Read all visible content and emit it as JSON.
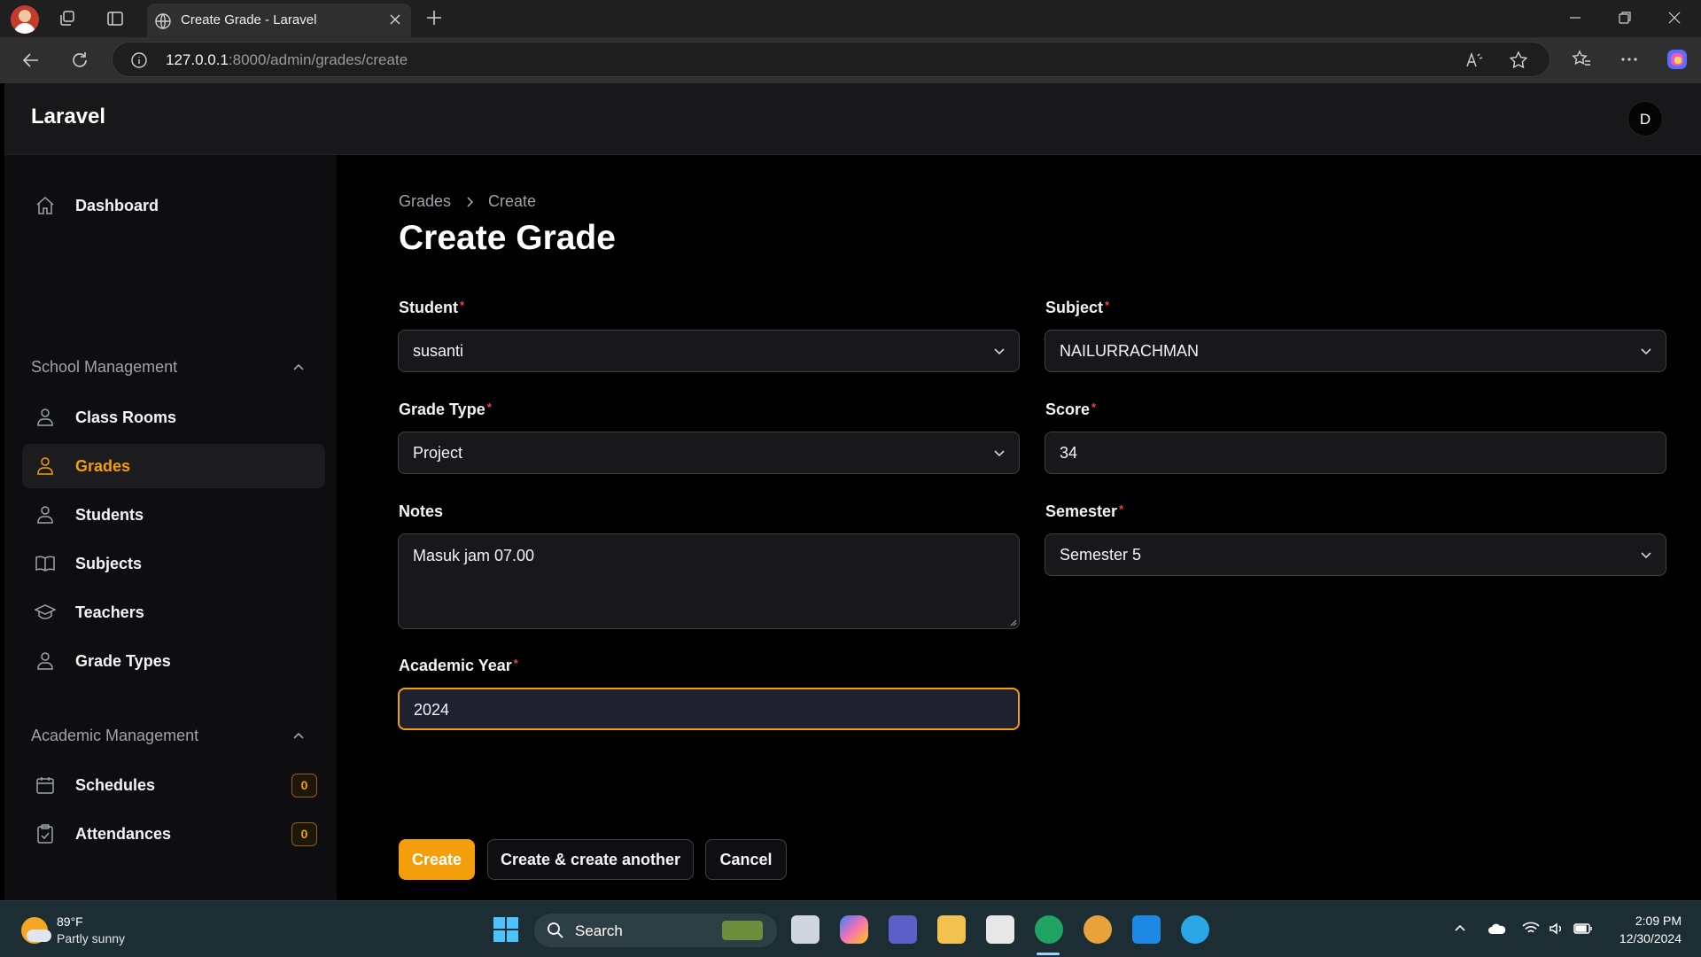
{
  "browser": {
    "tab_title": "Create Grade - Laravel",
    "url_host": "127.0.0.1",
    "url_rest": ":8000/admin/grades/create"
  },
  "app": {
    "brand": "Laravel",
    "avatar_initial": "D"
  },
  "sidebar": {
    "dashboard": "Dashboard",
    "group_school": "School Management",
    "school_items": [
      {
        "label": "Class Rooms",
        "icon": "user-icon"
      },
      {
        "label": "Grades",
        "icon": "user-icon",
        "active": true
      },
      {
        "label": "Students",
        "icon": "user-icon"
      },
      {
        "label": "Subjects",
        "icon": "book-icon"
      },
      {
        "label": "Teachers",
        "icon": "graduation-cap-icon"
      },
      {
        "label": "Grade Types",
        "icon": "user-icon"
      }
    ],
    "group_academic": "Academic Management",
    "academic_items": [
      {
        "label": "Schedules",
        "icon": "calendar-icon",
        "badge": "0"
      },
      {
        "label": "Attendances",
        "icon": "clipboard-check-icon",
        "badge": "0"
      }
    ]
  },
  "page": {
    "breadcrumb": [
      "Grades",
      "Create"
    ],
    "title": "Create Grade"
  },
  "form": {
    "student_label": "Student",
    "student_value": "susanti",
    "subject_label": "Subject",
    "subject_value": "NAILURRACHMAN",
    "grade_type_label": "Grade Type",
    "grade_type_value": "Project",
    "score_label": "Score",
    "score_value": "34",
    "notes_label": "Notes",
    "notes_value": "Masuk jam 07.00",
    "semester_label": "Semester",
    "semester_value": "Semester 5",
    "academic_year_label": "Academic Year",
    "academic_year_value": "2024",
    "required_mark": "*"
  },
  "actions": {
    "create": "Create",
    "create_another": "Create & create another",
    "cancel": "Cancel"
  },
  "taskbar": {
    "weather_temp": "89°F",
    "weather_desc": "Partly sunny",
    "search": "Search",
    "time": "2:09 PM",
    "date": "12/30/2024"
  },
  "colors": {
    "accent": "#f59e0b",
    "required": "#ef4444",
    "surface": "#18181b"
  }
}
